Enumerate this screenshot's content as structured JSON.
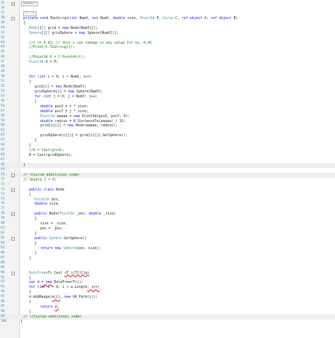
{
  "gutter": {
    "line_numbers": [
      "35",
      "36",
      "37",
      "38",
      "39",
      "40",
      "41",
      "42",
      "43",
      "44",
      "45",
      "46",
      "47",
      "48",
      "49",
      "50",
      "51",
      "52",
      "53",
      "54",
      "55",
      "56",
      "57",
      "58",
      "59",
      "60",
      "61",
      "62",
      "63",
      "64",
      "65",
      "66",
      "67",
      "68",
      "69",
      "70",
      "71",
      "72",
      "73",
      "74",
      "75",
      "76",
      "77",
      "78",
      "79",
      "80",
      "81",
      "82",
      "83",
      "84",
      "85",
      "86",
      "87",
      "88",
      "89",
      "90",
      "91",
      "92",
      "93",
      "94",
      "95",
      "96",
      "97",
      "98",
      "99",
      "100",
      "101",
      "102",
      "103",
      "104",
      "105",
      "106",
      "107",
      "108",
      "109",
      "110",
      "111",
      "112",
      "113",
      "114",
      "115",
      "116",
      "117"
    ]
  },
  "code": {
    "members_label": "Members",
    "ellipsis": "{...}",
    "l6_a": "private void ",
    "l6_b": "RunScript(",
    "l6_c": "int",
    "l6_d": " NumX, ",
    "l6_e": "int",
    "l6_f": " NumY, ",
    "l6_g": "double",
    "l6_h": " size, ",
    "l6_i": "Point3d",
    "l6_j": " P, ",
    "l6_k": "Curve",
    "l6_l": " C, ",
    "l6_m": "ref object",
    "l6_n": " A, ",
    "l6_o": "ref object",
    "l6_p": " B)",
    "l7": "{",
    "l8_a": "Node",
    "l8_b": "[][] grid = ",
    "l8_c": "new",
    "l8_d": " Node[NumX][];",
    "l9_a": "Sphere",
    "l9_b": "[][] gridSphere = ",
    "l9_c": "new",
    "l9_d": " Sphere[NumX][];",
    "l11": "//t == 0.01; // this u can change to any value for ex. 0.05",
    "l12": "//Print(t.ToString());",
    "l14": "//Point3d K = C.PointAt(t);",
    "l15_a": "Point3d",
    "l15_b": " K = P;",
    "l18_a": "for",
    "l18_b": " (",
    "l18_c": "int",
    "l18_d": " i = 0; i < NumX; i++)",
    "l19": "{",
    "l20_a": "grid[i] = ",
    "l20_b": "new",
    "l20_c": " Node[NumY];",
    "l21_a": "gridSphere[i] = ",
    "l21_b": "new",
    "l21_c": " Sphere[NumY];",
    "l22_a": "for",
    "l22_b": " (",
    "l22_c": "int",
    "l22_d": " j = 0; j < NumY; j++)",
    "l23": "{",
    "l24_a": "double",
    "l24_b": " posX = i * size;",
    "l25_a": "double",
    "l25_b": " posY = j * size;",
    "l26_a": "Point3d",
    "l26_b": " aaaaa = ",
    "l26_c": "new",
    "l26_d": " Point3d(posX, posY, 0);",
    "l27_a": "double",
    "l27_b": " radius = K.DistanceTo(aaaaa) / 15;",
    "l28_a": "grid[i][j] = ",
    "l28_b": "new",
    "l28_c": " Node(aaaaa, radius);",
    "l30": "gridSphere[i][j] = grid[i][j].GetSphere();",
    "l31": "}",
    "l32": "}",
    "l33": "//A = Cast(grid);",
    "l34": "B = Cast(gridSphere);",
    "l36": "}",
    "l38": "// <Custom additional code>",
    "l39": "// double t = 0;",
    "l41_a": "public class",
    "l41_b": " Node",
    "l42": "{",
    "l43_a": "Point3d",
    "l43_b": " pos;",
    "l44_a": "double",
    "l44_b": " size;",
    "l46_a": "public",
    "l46_b": " Node(",
    "l46_c": "Point3d",
    "l46_d": " _pos, ",
    "l46_e": "double",
    "l46_f": " _size)",
    "l47": "{",
    "l48": "size = _size;",
    "l49": "pos = _pos;",
    "l50": "}",
    "l51_a": "public",
    "l51_b": " Sphere",
    "l51_c": " GetSphere()",
    "l52": "{",
    "l53_a": "return new",
    "l53_b": " Sphere",
    "l53_c": "(pos, size);",
    "l54": "}",
    "l55": "}",
    "l58_a": "DataTree",
    "l58_b": "<T> Cast ",
    "l58_c": "<T >(T[][]a)",
    "l59": "{",
    "l60_a": "var",
    "l60_b": " d ",
    "l60_c": "= new",
    "l60_d": " DataTree<T>();",
    "l61_a": "for",
    "l61_b": " (",
    "l61_c": "int",
    "l61_d": " i = 0; i < a.Length",
    "l61_e": "; i++)",
    "l62": "{",
    "l63_a": "d.AddRange(",
    "l63_b": "a[i]",
    "l63_c": ", new",
    "l63_d": " GH_Path(i));",
    "l64": "}",
    "l65_a": "return ",
    "l65_b": "d;",
    "l66": "}",
    "l67": "// </Custom additional code>",
    "l68": "}"
  }
}
